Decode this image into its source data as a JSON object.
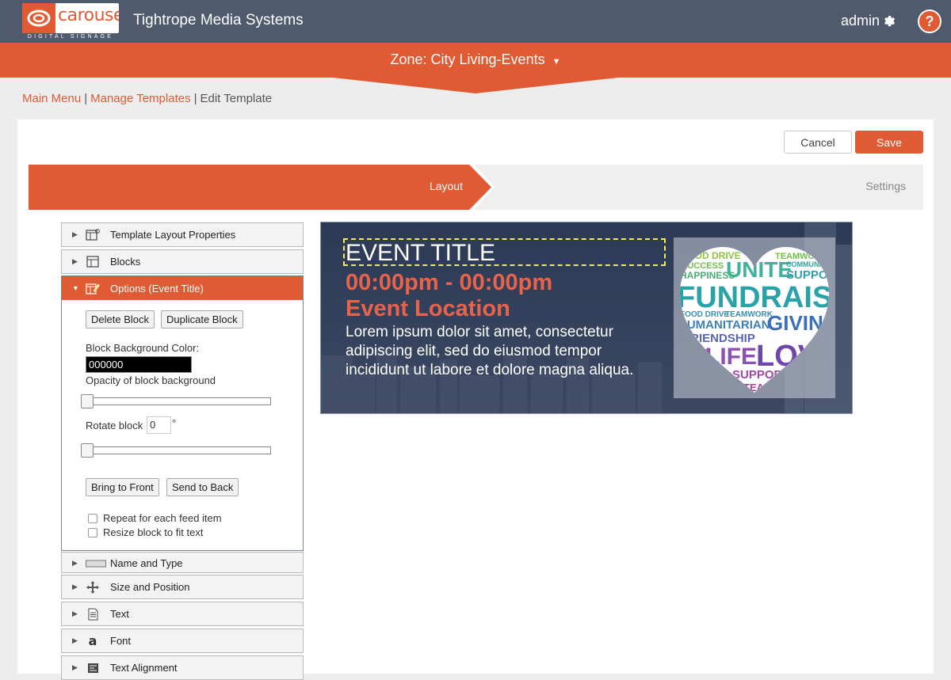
{
  "header": {
    "logo_word": "carousel",
    "logo_tagline": "DIGITAL SIGNAGE",
    "company": "Tightrope Media Systems",
    "user": "admin",
    "help": "?"
  },
  "zone": {
    "label": "Zone: City Living-Events"
  },
  "breadcrumb": {
    "main": "Main Menu",
    "templates": "Manage Templates",
    "current": "Edit Template",
    "sep": "|"
  },
  "actions": {
    "cancel": "Cancel",
    "save": "Save"
  },
  "steps": {
    "layout": "Layout",
    "settings": "Settings"
  },
  "accordion": {
    "template_props": "Template Layout Properties",
    "blocks": "Blocks",
    "options": "Options (Event Title)",
    "name_type": "Name and Type",
    "size_position": "Size and Position",
    "text": "Text",
    "font": "Font",
    "text_alignment": "Text Alignment"
  },
  "options": {
    "delete": "Delete Block",
    "duplicate": "Duplicate Block",
    "bg_color_label": "Block Background Color:",
    "bg_color_value": "000000",
    "opacity_label": "Opacity of block background",
    "opacity_value": 0,
    "rotate_label": "Rotate block",
    "rotate_value": "0",
    "rotate_unit": "°",
    "rotate_slider_value": 0,
    "bring_front": "Bring to Front",
    "send_back": "Send to Back",
    "repeat_label": "Repeat for each feed item",
    "resize_label": "Resize block to fit text"
  },
  "preview": {
    "title": "EVENT TITLE",
    "time": "00:00pm - 00:00pm",
    "location": "Event Location",
    "description": "Lorem ipsum dolor sit amet, consectetur adipiscing elit, sed do eiusmod tempor incididunt ut labore et dolore magna aliqua.",
    "words": [
      "GOOD DRIVE",
      "TEAMWORK",
      "SUCCESS",
      "UNITE",
      "COMMUNITY",
      "HAPPINESS",
      "SUPPORT",
      "FUNDRAISER",
      "FOOD DRIVE",
      "TEAMWORK",
      "HUMANITARIAN",
      "GIVING",
      "FRIENDSHIP",
      "LESS",
      "LIFE",
      "LOVE",
      "SUPPORT",
      "TEAM"
    ]
  },
  "colors": {
    "accent": "#e05a33",
    "topbar": "#4f5a6d",
    "selection": "#f3ea5a"
  }
}
